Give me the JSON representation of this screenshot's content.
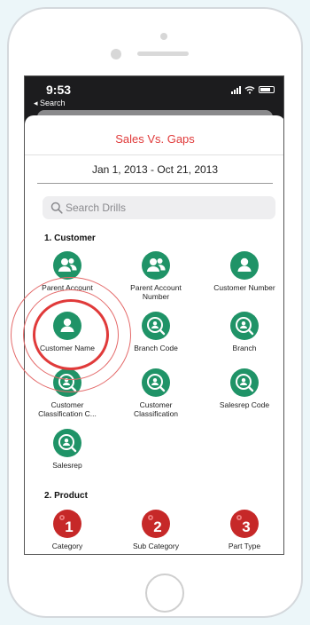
{
  "status_bar": {
    "time": "9:53",
    "back_label": "◂ Search"
  },
  "header": {
    "title": "Sales Vs. Gaps",
    "date_range": "Jan 1, 2013 - Oct 21, 2013"
  },
  "search": {
    "placeholder": "Search Drills",
    "value": ""
  },
  "sections": [
    {
      "title": "1. Customer",
      "items": [
        {
          "label": "Parent Account",
          "icon": "people-icon"
        },
        {
          "label": "Parent Account Number",
          "icon": "people-icon"
        },
        {
          "label": "Customer Number",
          "icon": "person-icon"
        },
        {
          "label": "Customer Name",
          "icon": "person-icon"
        },
        {
          "label": "Branch Code",
          "icon": "person-search-icon"
        },
        {
          "label": "Branch",
          "icon": "person-search-icon"
        },
        {
          "label": "Customer Classification C...",
          "icon": "person-search-icon"
        },
        {
          "label": "Customer Classification",
          "icon": "person-search-icon"
        },
        {
          "label": "Salesrep Code",
          "icon": "person-search-icon"
        },
        {
          "label": "Salesrep",
          "icon": "person-search-icon"
        }
      ]
    },
    {
      "title": "2. Product",
      "items": [
        {
          "label": "Category",
          "icon": "gear-number-icon",
          "number": "1"
        },
        {
          "label": "Sub Category",
          "icon": "gear-number-icon",
          "number": "2"
        },
        {
          "label": "Part Type",
          "icon": "gear-number-icon",
          "number": "3"
        }
      ]
    }
  ],
  "colors": {
    "accent": "#e03a3a",
    "green": "#1f9367",
    "product_red": "#c62828",
    "annotation": "#e46a6a"
  }
}
